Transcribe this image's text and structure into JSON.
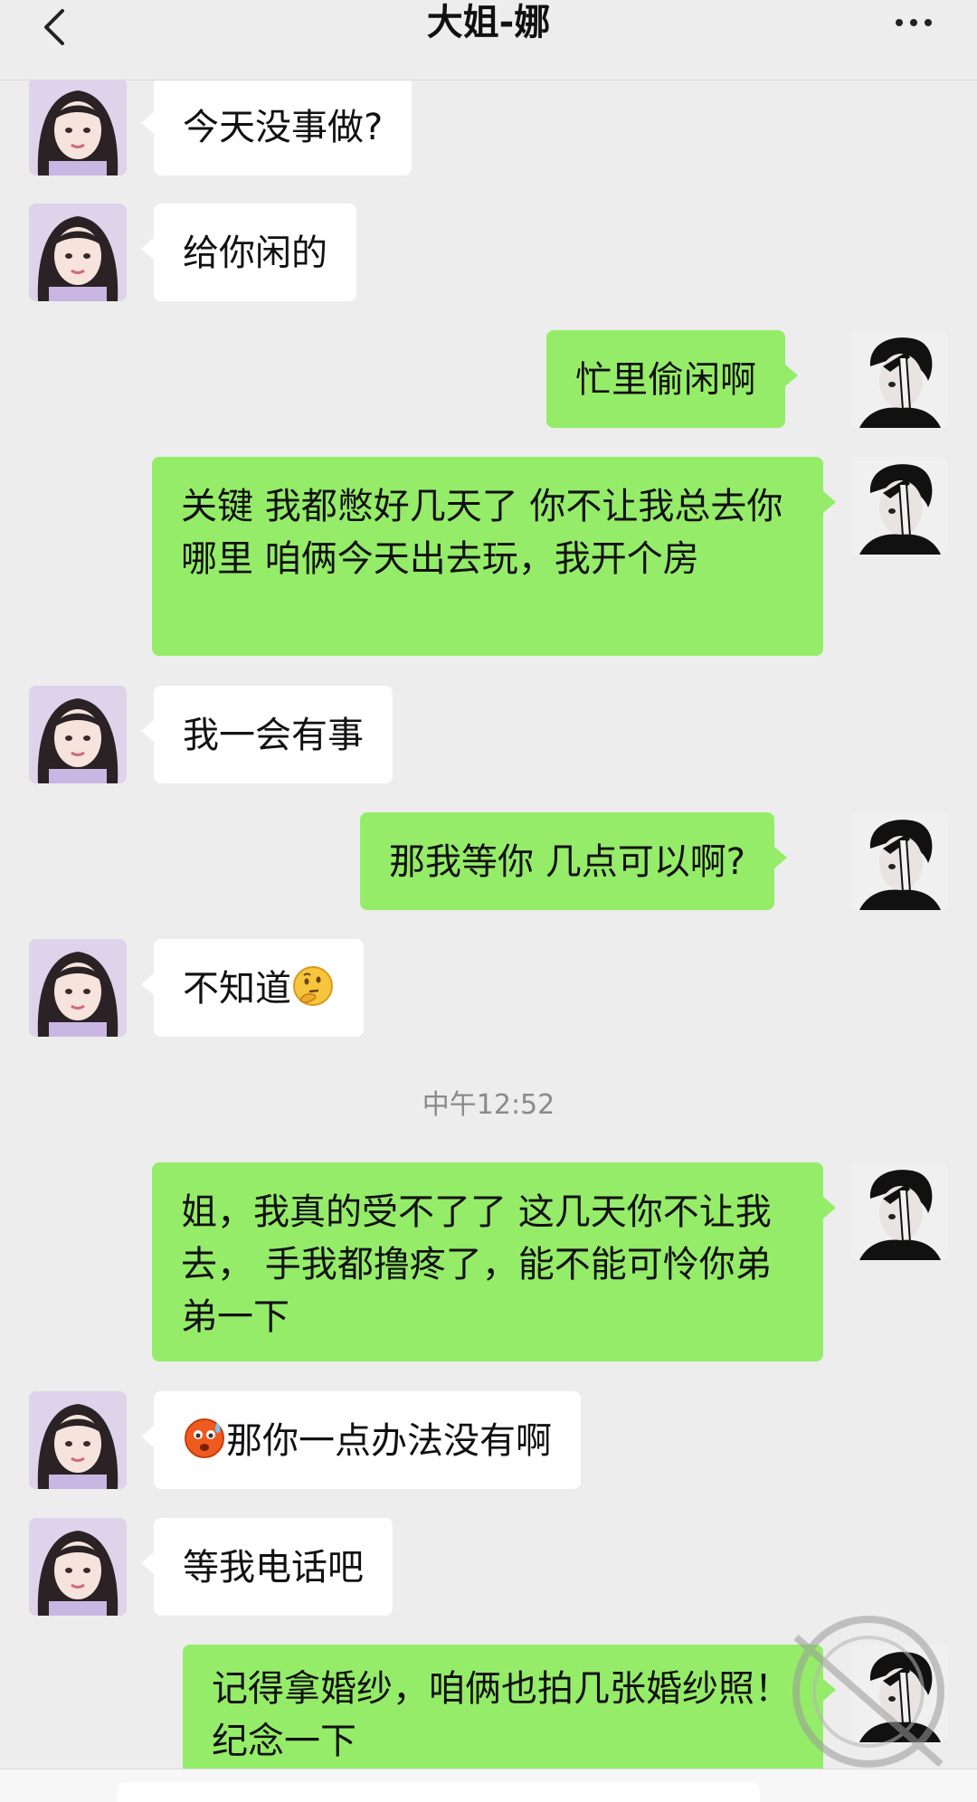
{
  "header": {
    "title": "大姐-娜",
    "back_icon": "chevron-left-icon",
    "more_icon": "more-dots-icon"
  },
  "messages": [
    {
      "side": "left",
      "text": "今天没事做?"
    },
    {
      "side": "left",
      "text": "给你闲的"
    },
    {
      "side": "right",
      "text": "忙里偷闲啊"
    },
    {
      "side": "right",
      "text": "关键 我都憋好几天了  你不让我总去你哪里   咱俩今天出去玩，我开个房"
    },
    {
      "side": "left",
      "text": "我一会有事"
    },
    {
      "side": "right",
      "text": "那我等你 几点可以啊?"
    },
    {
      "side": "left",
      "text": "不知道",
      "emoji": "thinking-face"
    },
    {
      "side": "right",
      "text": "姐，我真的受不了了 这几天你不让我去， 手我都撸疼了，能不能可怜你弟弟一下"
    },
    {
      "side": "left",
      "text": "那你一点办法没有啊",
      "emoji": "sweat-face"
    },
    {
      "side": "left",
      "text": "等我电话吧"
    },
    {
      "side": "right",
      "text": "记得拿婚纱，咱俩也拍几张婚纱照！纪念一下"
    }
  ],
  "timestamp": "中午12:52",
  "colors": {
    "background": "#ededed",
    "sent_bubble": "#95ec69",
    "received_bubble": "#ffffff",
    "timestamp_text": "#8a8a8a"
  }
}
